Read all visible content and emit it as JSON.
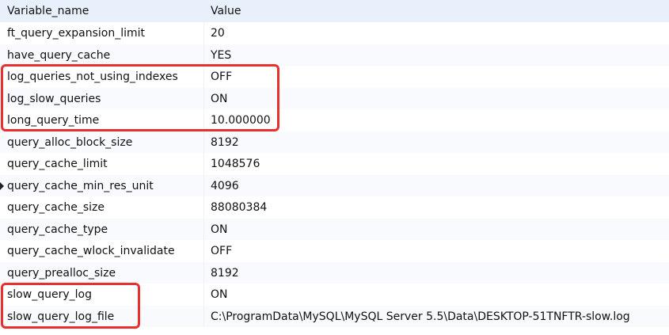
{
  "columns": {
    "name": "Variable_name",
    "value": "Value"
  },
  "rows": [
    {
      "name": "ft_query_expansion_limit",
      "value": "20"
    },
    {
      "name": "have_query_cache",
      "value": "YES"
    },
    {
      "name": "log_queries_not_using_indexes",
      "value": "OFF"
    },
    {
      "name": "log_slow_queries",
      "value": "ON"
    },
    {
      "name": "long_query_time",
      "value": "10.000000"
    },
    {
      "name": "query_alloc_block_size",
      "value": "8192"
    },
    {
      "name": "query_cache_limit",
      "value": "1048576"
    },
    {
      "name": "query_cache_min_res_unit",
      "value": "4096"
    },
    {
      "name": "query_cache_size",
      "value": "88080384"
    },
    {
      "name": "query_cache_type",
      "value": "ON"
    },
    {
      "name": "query_cache_wlock_invalidate",
      "value": "OFF"
    },
    {
      "name": "query_prealloc_size",
      "value": "8192"
    },
    {
      "name": "slow_query_log",
      "value": "ON"
    },
    {
      "name": "slow_query_log_file",
      "value": "C:\\ProgramData\\MySQL\\MySQL Server 5.5\\Data\\DESKTOP-51TNFTR-slow.log"
    }
  ],
  "current_row_index": 7,
  "highlight_color": "#e8312f"
}
